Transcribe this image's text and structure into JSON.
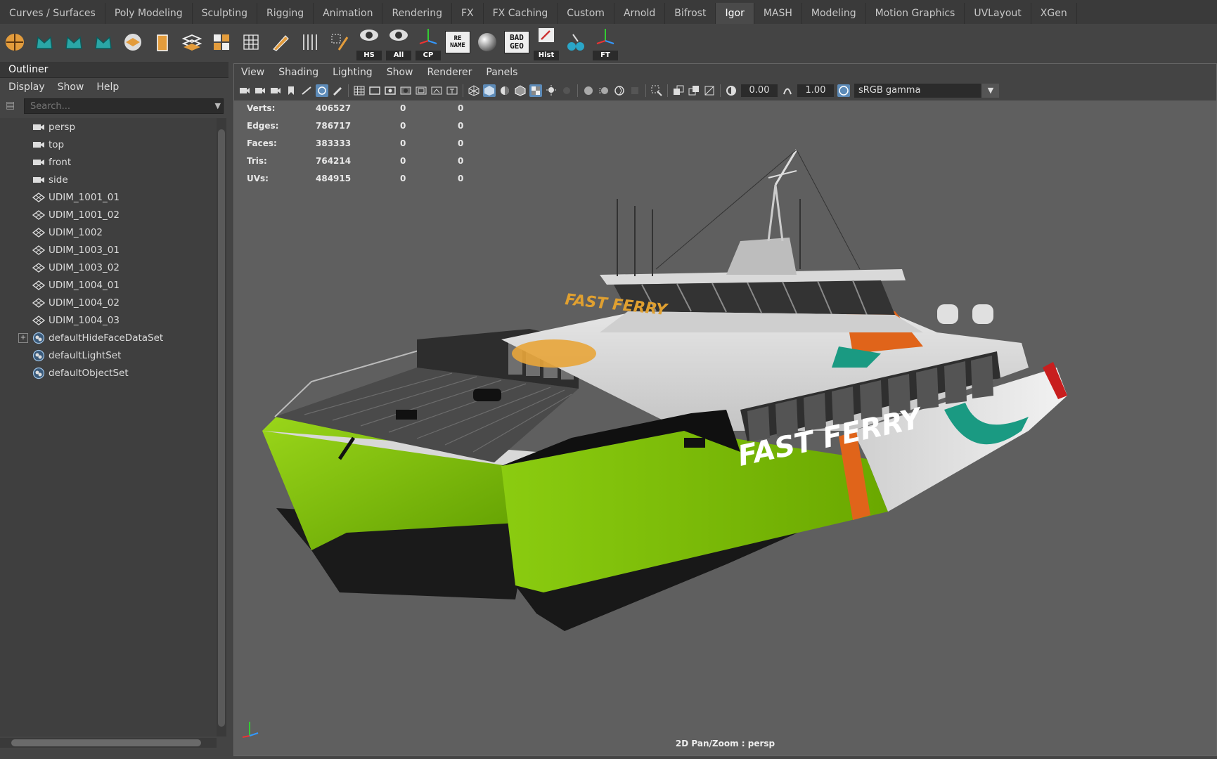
{
  "shelf": {
    "tabs": [
      "Curves / Surfaces",
      "Poly Modeling",
      "Sculpting",
      "Rigging",
      "Animation",
      "Rendering",
      "FX",
      "FX Caching",
      "Custom",
      "Arnold",
      "Bifrost",
      "Igor",
      "MASH",
      "Modeling",
      "Motion Graphics",
      "UVLayout",
      "XGen"
    ],
    "active_tab": "Igor",
    "icons": [
      {
        "name": "mesh-orange-icon"
      },
      {
        "name": "teal-crown-icon"
      },
      {
        "name": "teal-crown-icon-2"
      },
      {
        "name": "teal-crown-icon-3"
      },
      {
        "name": "sphere-orange-icon"
      },
      {
        "name": "box-orange-icon"
      },
      {
        "name": "layers-icon"
      },
      {
        "name": "grid-blocks-icon"
      },
      {
        "name": "lattice-icon"
      },
      {
        "name": "pencil-icon"
      },
      {
        "name": "columns-icon"
      },
      {
        "name": "select-brush-icon"
      }
    ],
    "labeled_icons": {
      "hs": "HS",
      "all": "All",
      "cp": "CP",
      "rename": "RE NAME",
      "badgeo": "BAD GEO",
      "hist": "Hist",
      "ft": "FT"
    }
  },
  "outliner": {
    "title": "Outliner",
    "menu": [
      "Display",
      "Show",
      "Help"
    ],
    "search_placeholder": "Search...",
    "items": [
      {
        "label": "persp",
        "icon": "camera-icon"
      },
      {
        "label": "top",
        "icon": "camera-icon"
      },
      {
        "label": "front",
        "icon": "camera-icon"
      },
      {
        "label": "side",
        "icon": "camera-icon"
      },
      {
        "label": "UDIM_1001_01",
        "icon": "mesh-icon"
      },
      {
        "label": "UDIM_1001_02",
        "icon": "mesh-icon"
      },
      {
        "label": "UDIM_1002",
        "icon": "mesh-icon"
      },
      {
        "label": "UDIM_1003_01",
        "icon": "mesh-icon"
      },
      {
        "label": "UDIM_1003_02",
        "icon": "mesh-icon"
      },
      {
        "label": "UDIM_1004_01",
        "icon": "mesh-icon"
      },
      {
        "label": "UDIM_1004_02",
        "icon": "mesh-icon"
      },
      {
        "label": "UDIM_1004_03",
        "icon": "mesh-icon"
      },
      {
        "label": "defaultHideFaceDataSet",
        "icon": "set-icon",
        "expandable": true
      },
      {
        "label": "defaultLightSet",
        "icon": "set-icon"
      },
      {
        "label": "defaultObjectSet",
        "icon": "set-icon"
      }
    ]
  },
  "viewport": {
    "menu": [
      "View",
      "Shading",
      "Lighting",
      "Show",
      "Renderer",
      "Panels"
    ],
    "exposure": "0.00",
    "gamma": "1.00",
    "color_space": "sRGB gamma",
    "camera_label": "2D Pan/Zoom : persp",
    "hud": [
      {
        "label": "Verts:",
        "v": "406527",
        "a": "0",
        "b": "0"
      },
      {
        "label": "Edges:",
        "v": "786717",
        "a": "0",
        "b": "0"
      },
      {
        "label": "Faces:",
        "v": "383333",
        "a": "0",
        "b": "0"
      },
      {
        "label": "Tris:",
        "v": "764214",
        "a": "0",
        "b": "0"
      },
      {
        "label": "UVs:",
        "v": "484915",
        "a": "0",
        "b": "0"
      }
    ],
    "hull_text": "FAST FERRY",
    "deck_text": "FAST FERRY",
    "colors": {
      "green": "#7cc400",
      "orange": "#e0641a",
      "teal": "#1a9a82",
      "red": "#c81e1e",
      "hull": "#dedede",
      "bottom": "#1a1a1a",
      "sun": "#e8a53a"
    }
  }
}
